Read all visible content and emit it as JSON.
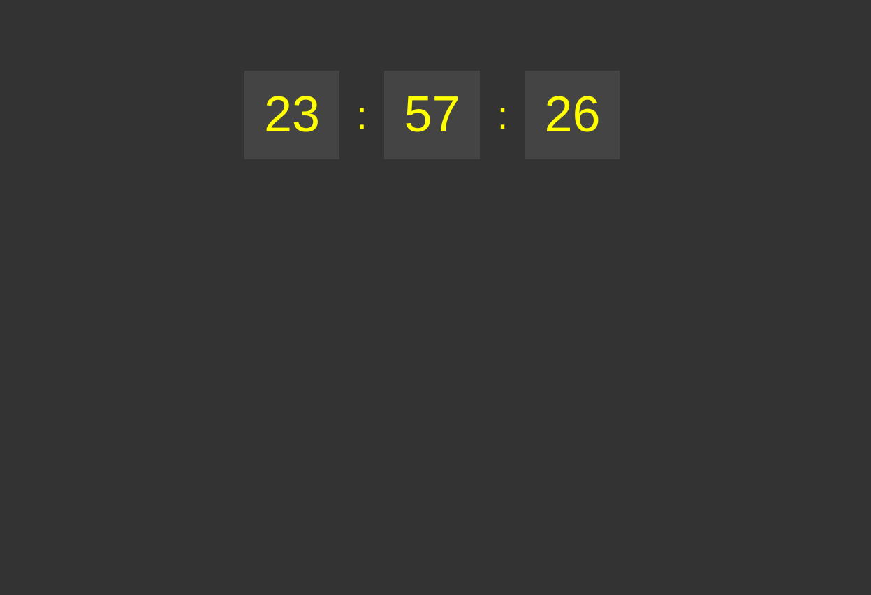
{
  "clock": {
    "hours": "23",
    "minutes": "57",
    "seconds": "26",
    "separator": ":"
  },
  "colors": {
    "background": "#333333",
    "box": "#444444",
    "digits": "#ffff00"
  }
}
